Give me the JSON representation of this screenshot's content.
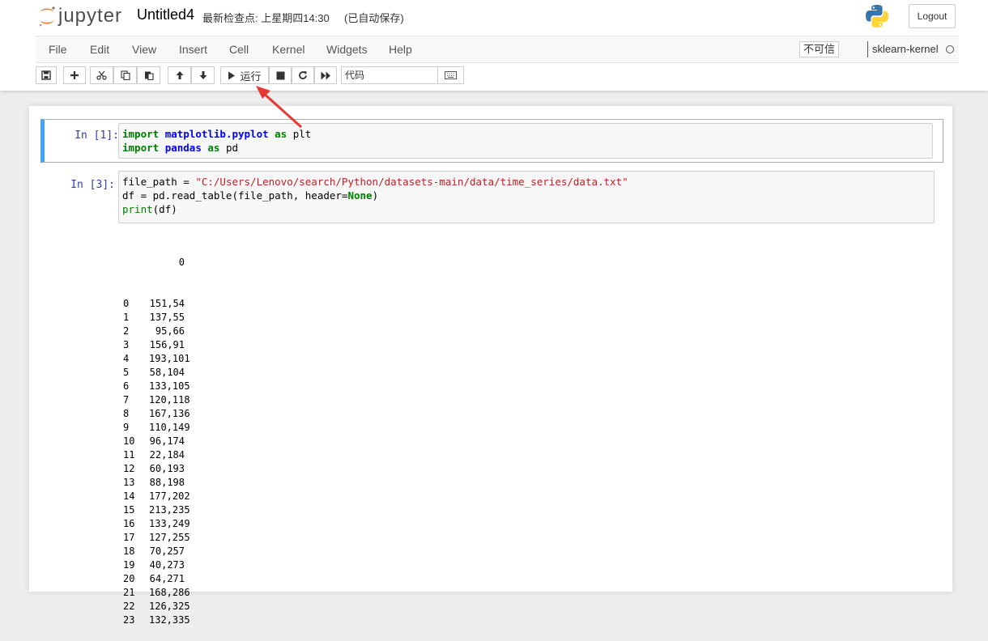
{
  "header": {
    "logo_text": "jupyter",
    "notebook_name": "Untitled4",
    "checkpoint": "最新检查点: 上星期四14:30",
    "autosave": "(已自动保存)",
    "logout_label": "Logout"
  },
  "menu": {
    "items": [
      "File",
      "Edit",
      "View",
      "Insert",
      "Cell",
      "Kernel",
      "Widgets",
      "Help"
    ],
    "trust": "不可信",
    "kernel_name": "sklearn-kernel"
  },
  "toolbar": {
    "run_label": "运行",
    "cell_type": "代码"
  },
  "cells": [
    {
      "prompt": "In  [1]:",
      "lines": [
        "import matplotlib.pyplot as plt",
        "import pandas as pd"
      ]
    },
    {
      "prompt": "In  [3]:",
      "lines": [
        "file_path = \"C:/Users/Lenovo/search/Python/datasets-main/data/time_series/data.txt\"",
        "df = pd.read_table(file_path, header=None)",
        "print(df)"
      ]
    }
  ],
  "output": {
    "header": "0",
    "rows": [
      [
        "0",
        "151,54"
      ],
      [
        "1",
        "137,55"
      ],
      [
        "2",
        "95,66"
      ],
      [
        "3",
        "156,91"
      ],
      [
        "4",
        "193,101"
      ],
      [
        "5",
        "58,104"
      ],
      [
        "6",
        "133,105"
      ],
      [
        "7",
        "120,118"
      ],
      [
        "8",
        "167,136"
      ],
      [
        "9",
        "110,149"
      ],
      [
        "10",
        "96,174"
      ],
      [
        "11",
        "22,184"
      ],
      [
        "12",
        "60,193"
      ],
      [
        "13",
        "88,198"
      ],
      [
        "14",
        "177,202"
      ],
      [
        "15",
        "213,235"
      ],
      [
        "16",
        "133,249"
      ],
      [
        "17",
        "127,255"
      ],
      [
        "18",
        "70,257"
      ],
      [
        "19",
        "40,273"
      ],
      [
        "20",
        "64,271"
      ],
      [
        "21",
        "168,286"
      ],
      [
        "22",
        "126,325"
      ],
      [
        "23",
        "132,335"
      ]
    ]
  },
  "colors": {
    "accent": "#42a5f5",
    "annotation_arrow": "#e53935"
  }
}
